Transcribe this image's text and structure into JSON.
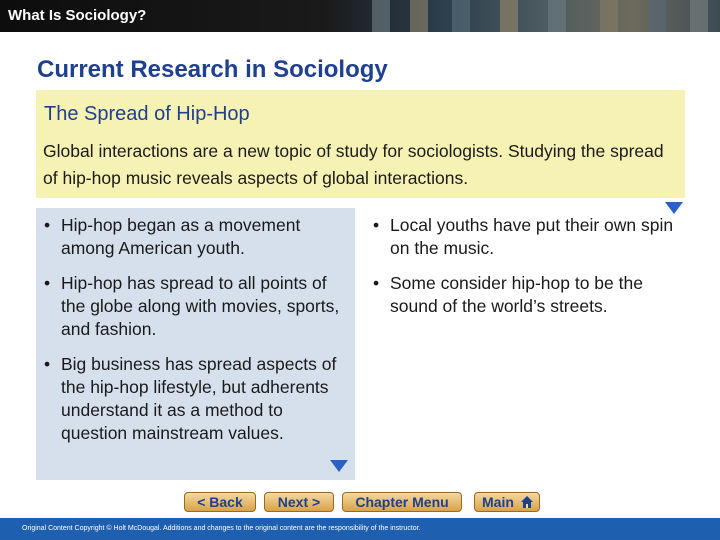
{
  "header": {
    "title": "What Is Sociology?"
  },
  "slide": {
    "title": "Current Research in Sociology"
  },
  "intro": {
    "heading": "The Spread of Hip-Hop",
    "text": "Global interactions are a new topic of study for sociologists. Studying the spread of hip-hop music reveals aspects of global interactions."
  },
  "left_bullets": [
    "Hip-hop began as a movement among American youth.",
    "Hip-hop has spread to all points of the globe along with movies, sports, and fashion.",
    "Big business has spread aspects of the hip-hop lifestyle, but adherents understand it as a method to question mainstream values."
  ],
  "right_bullets": [
    "Local youths have put their own spin on the music.",
    "Some consider hip-hop to be the sound of the world’s streets."
  ],
  "bullet_symbol": "•",
  "nav": {
    "back_label": "< Back",
    "next_label": "Next >",
    "menu_label": "Chapter Menu",
    "main_label": "Main"
  },
  "footer": {
    "text": "Original Content Copyright © Holt McDougal. Additions and changes to the original content are the responsibility of the instructor."
  },
  "colors": {
    "title_blue": "#1f3f8f",
    "highlight_yellow": "#f6f2b4",
    "panel_blue": "#d6e0ec",
    "footer_blue": "#1f5fb0",
    "arrow_blue": "#2a60c8"
  },
  "icons": {
    "arrow": "triangle-down-icon",
    "home": "house-icon"
  }
}
